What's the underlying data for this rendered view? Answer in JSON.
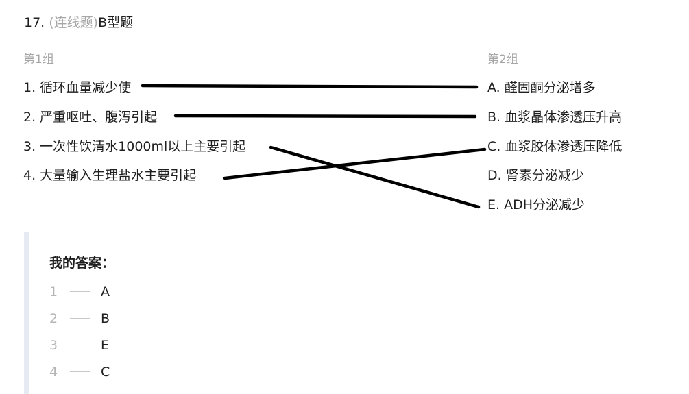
{
  "question": {
    "number": "17.",
    "type": "(连线题)",
    "title": "B型题"
  },
  "group1": {
    "label": "第1组",
    "items": [
      "1. 循环血量减少使",
      "2. 严重呕吐、腹泻引起",
      "3. 一次性饮清水1000ml以上主要引起",
      "4. 大量输入生理盐水主要引起"
    ]
  },
  "group2": {
    "label": "第2组",
    "items": [
      "A. 醛固酮分泌增多",
      "B. 血浆晶体渗透压升高",
      "C. 血浆胶体渗透压降低",
      "D. 肾素分泌减少",
      "E. ADH分泌减少"
    ]
  },
  "connections": [
    {
      "from": 1,
      "to": "A"
    },
    {
      "from": 2,
      "to": "B"
    },
    {
      "from": 3,
      "to": "E"
    },
    {
      "from": 4,
      "to": "C"
    }
  ],
  "answer": {
    "title": "我的答案：",
    "rows": [
      {
        "num": "1",
        "letter": "A"
      },
      {
        "num": "2",
        "letter": "B"
      },
      {
        "num": "3",
        "letter": "E"
      },
      {
        "num": "4",
        "letter": "C"
      }
    ]
  },
  "colors": {
    "muted": "#a6a6a6",
    "text": "#1f1f1f",
    "line": "#000000",
    "panel_border": "#e6ebf3"
  }
}
